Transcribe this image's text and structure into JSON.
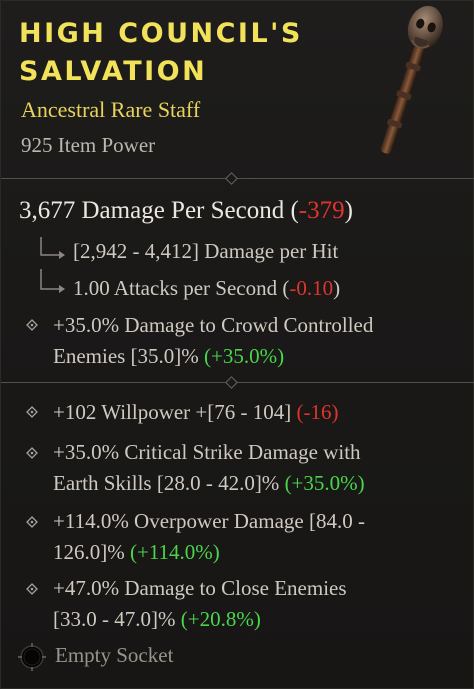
{
  "item": {
    "name": "High Council's Salvation",
    "rarity_type": "Ancestral Rare Staff",
    "item_power": "925 Item Power"
  },
  "weapon": {
    "dps_text": "3,677 Damage Per Second",
    "dps_delta_open": "(",
    "dps_delta": "-379",
    "dps_delta_close": ")",
    "hit_text": "[2,942 - 4,412] Damage per Hit",
    "aps_text": "1.00 Attacks per Second",
    "aps_delta_open": "(",
    "aps_delta": "-0.10",
    "aps_delta_close": ")"
  },
  "implicit": {
    "line1": "+35.0% Damage to Crowd Controlled",
    "line2": "Enemies [35.0]%",
    "delta": "(+35.0%)"
  },
  "affixes": [
    {
      "line1": "+102 Willpower +[76 - 104]",
      "delta": "(-16)",
      "delta_color": "red"
    },
    {
      "line1": "+35.0% Critical Strike Damage with",
      "line2": "Earth Skills [28.0 - 42.0]%",
      "delta": "(+35.0%)",
      "delta_color": "green"
    },
    {
      "line1": "+114.0% Overpower Damage [84.0 -",
      "line2": "126.0]%",
      "delta": "(+114.0%)",
      "delta_color": "green"
    },
    {
      "line1": "+47.0% Damage to Close Enemies",
      "line2": "[33.0 - 47.0]%",
      "delta": "(+20.8%)",
      "delta_color": "green"
    }
  ],
  "socket": {
    "label": "Empty Socket"
  },
  "colors": {
    "title": "#f1e25a",
    "rare": "#e8d45a",
    "negative": "#e0342e",
    "positive": "#49d64a"
  },
  "icons": {
    "item_art": "skull-staff-icon",
    "affix_bullet": "diamond-bullet-icon",
    "socket": "empty-socket-icon"
  }
}
